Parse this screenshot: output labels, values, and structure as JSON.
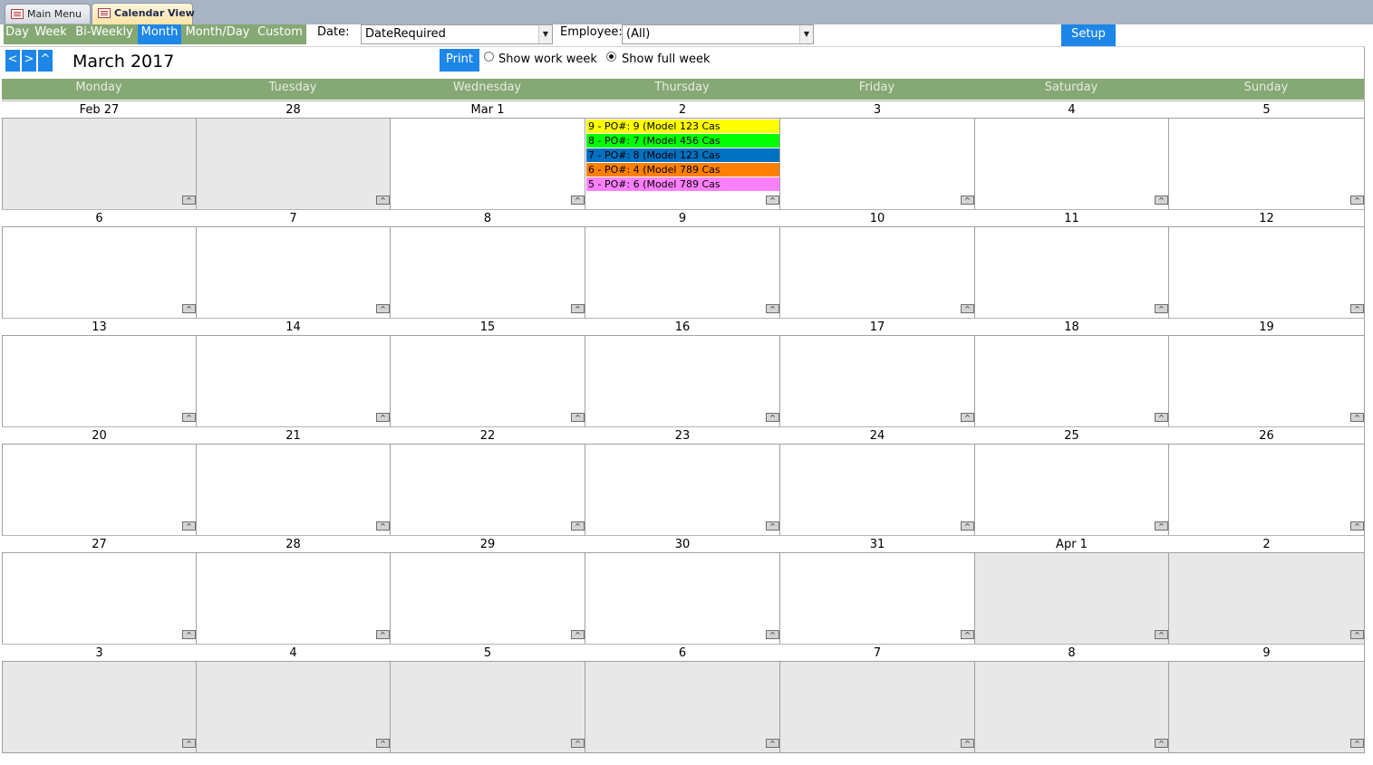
{
  "tabs": [
    {
      "label": "Main Menu",
      "active": false
    },
    {
      "label": "Calendar View",
      "active": true
    }
  ],
  "view_buttons": [
    {
      "label": "Day",
      "active": false
    },
    {
      "label": "Week",
      "active": false
    },
    {
      "label": "Bi-Weekly",
      "active": false
    },
    {
      "label": "Month",
      "active": true
    },
    {
      "label": "Month/Day",
      "active": false
    },
    {
      "label": "Custom",
      "active": false
    }
  ],
  "filters": {
    "date_label": "Date:",
    "date_value": "DateRequired",
    "employee_label": "Employee:",
    "employee_value": "(All)"
  },
  "setup_label": "Setup",
  "nav": {
    "prev": "<",
    "next": ">",
    "up": "^"
  },
  "month_title": "March 2017",
  "print_label": "Print",
  "week_options": [
    {
      "label": "Show work week",
      "selected": false
    },
    {
      "label": "Show full week",
      "selected": true
    }
  ],
  "day_names": [
    "Monday",
    "Tuesday",
    "Wednesday",
    "Thursday",
    "Friday",
    "Saturday",
    "Sunday"
  ],
  "more_glyph": "^",
  "weeks": [
    [
      {
        "date": "Feb 27",
        "out": true
      },
      {
        "date": "28",
        "out": true
      },
      {
        "date": "Mar 1"
      },
      {
        "date": "2",
        "events": [
          {
            "text": "9 - PO#: 9 (Model 123 Cas",
            "color": "#ffff00"
          },
          {
            "text": "8 - PO#: 7 (Model 456 Cas",
            "color": "#00ff00"
          },
          {
            "text": "7 - PO#: 8 (Model 123 Cas",
            "color": "#0070c0"
          },
          {
            "text": "6 - PO#: 4 (Model 789 Cas",
            "color": "#ff8000"
          },
          {
            "text": "5 - PO#: 6 (Model 789 Cas",
            "color": "#ff80ff"
          }
        ]
      },
      {
        "date": "3"
      },
      {
        "date": "4"
      },
      {
        "date": "5"
      }
    ],
    [
      {
        "date": "6"
      },
      {
        "date": "7"
      },
      {
        "date": "8"
      },
      {
        "date": "9"
      },
      {
        "date": "10"
      },
      {
        "date": "11"
      },
      {
        "date": "12"
      }
    ],
    [
      {
        "date": "13"
      },
      {
        "date": "14"
      },
      {
        "date": "15"
      },
      {
        "date": "16"
      },
      {
        "date": "17"
      },
      {
        "date": "18"
      },
      {
        "date": "19"
      }
    ],
    [
      {
        "date": "20"
      },
      {
        "date": "21"
      },
      {
        "date": "22"
      },
      {
        "date": "23"
      },
      {
        "date": "24"
      },
      {
        "date": "25"
      },
      {
        "date": "26"
      }
    ],
    [
      {
        "date": "27"
      },
      {
        "date": "28"
      },
      {
        "date": "29"
      },
      {
        "date": "30"
      },
      {
        "date": "31"
      },
      {
        "date": "Apr 1",
        "out": true
      },
      {
        "date": "2",
        "out": true
      }
    ],
    [
      {
        "date": "3",
        "out": true
      },
      {
        "date": "4",
        "out": true
      },
      {
        "date": "5",
        "out": true
      },
      {
        "date": "6",
        "out": true
      },
      {
        "date": "7",
        "out": true
      },
      {
        "date": "8",
        "out": true
      },
      {
        "date": "9",
        "out": true
      }
    ]
  ]
}
